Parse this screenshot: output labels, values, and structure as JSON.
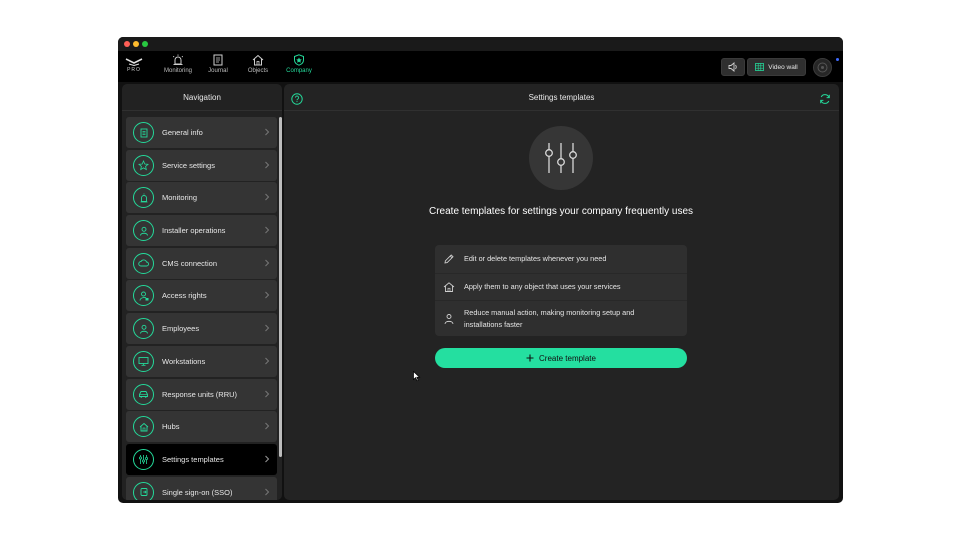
{
  "brand": {
    "logo_text": "PRO"
  },
  "top_nav": {
    "tabs": [
      {
        "label": "Monitoring",
        "icon": "alarm-bell-icon",
        "active": false
      },
      {
        "label": "Journal",
        "icon": "journal-icon",
        "active": false
      },
      {
        "label": "Objects",
        "icon": "house-icon",
        "active": false
      },
      {
        "label": "Company",
        "icon": "shield-icon",
        "active": true
      }
    ],
    "video_wall_label": "Video wall"
  },
  "sidebar": {
    "title": "Navigation",
    "items": [
      {
        "label": "General info",
        "icon": "document-icon"
      },
      {
        "label": "Service settings",
        "icon": "star-icon"
      },
      {
        "label": "Monitoring",
        "icon": "alarm-icon"
      },
      {
        "label": "Installer operations",
        "icon": "installer-icon"
      },
      {
        "label": "CMS connection",
        "icon": "cloud-icon"
      },
      {
        "label": "Access rights",
        "icon": "user-lock-icon"
      },
      {
        "label": "Employees",
        "icon": "user-icon"
      },
      {
        "label": "Workstations",
        "icon": "monitor-icon"
      },
      {
        "label": "Response units (RRU)",
        "icon": "car-icon"
      },
      {
        "label": "Hubs",
        "icon": "hub-icon"
      },
      {
        "label": "Settings templates",
        "icon": "sliders-icon",
        "active": true
      },
      {
        "label": "Single sign-on (SSO)",
        "icon": "sso-icon"
      }
    ]
  },
  "main": {
    "title": "Settings templates",
    "headline": "Create templates for settings your company frequently uses",
    "benefits": [
      {
        "text": "Edit or delete templates whenever you need",
        "icon": "pencil-icon"
      },
      {
        "text": "Apply them to any object that uses your services",
        "icon": "house-icon"
      },
      {
        "text": "Reduce manual action, making monitoring setup and installations faster",
        "icon": "person-icon"
      }
    ],
    "create_button_label": "Create template"
  },
  "colors": {
    "accent": "#24d99a",
    "button": "#24dfa0",
    "panel": "#232323",
    "item": "#343434"
  }
}
